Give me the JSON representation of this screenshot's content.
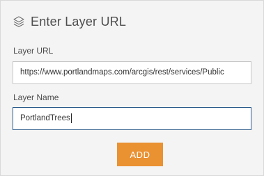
{
  "dialog": {
    "title": "Enter Layer URL",
    "title_icon": "layers-icon"
  },
  "layer_url": {
    "label": "Layer URL",
    "value": "https://www.portlandmaps.com/arcgis/rest/services/Public"
  },
  "layer_name": {
    "label": "Layer Name",
    "value": "PortlandTrees"
  },
  "add_button": {
    "label": "ADD",
    "color": "#ea9132"
  }
}
